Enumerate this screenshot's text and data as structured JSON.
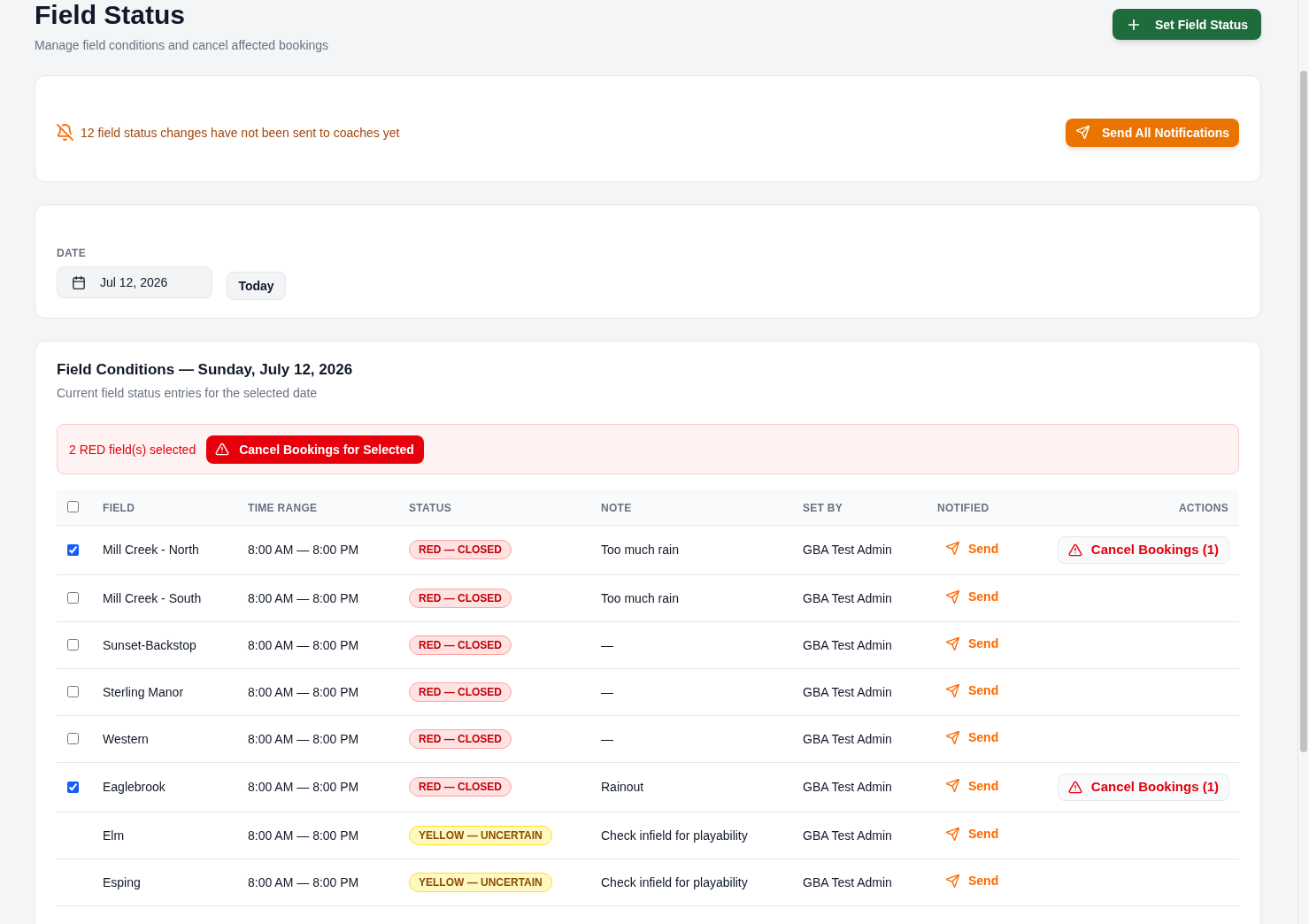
{
  "header": {
    "title": "Field Status",
    "subtitle": "Manage field conditions and cancel affected bookings",
    "primary_button": "Set Field Status"
  },
  "notification_banner": {
    "message": "12 field status changes have not been sent to coaches yet",
    "button": "Send All Notifications"
  },
  "date_filter": {
    "label": "DATE",
    "value": "Jul 12, 2026",
    "today_button": "Today"
  },
  "conditions": {
    "title": "Field Conditions — Sunday, July 12, 2026",
    "subtitle": "Current field status entries for the selected date",
    "selection_bar": {
      "message": "2 RED field(s) selected",
      "button": "Cancel Bookings for Selected"
    },
    "table": {
      "select_all": {
        "checked": false
      },
      "columns": [
        "FIELD",
        "TIME RANGE",
        "STATUS",
        "NOTE",
        "SET BY",
        "NOTIFIED",
        "ACTIONS"
      ],
      "rows": [
        {
          "selectable": true,
          "checked": true,
          "field": "Mill Creek - North",
          "time_range": "8:00 AM — 8:00 PM",
          "status": {
            "kind": "red",
            "label": "RED — CLOSED"
          },
          "note": "Too much rain",
          "set_by": "GBA Test Admin",
          "notify": "Send",
          "action": "Cancel Bookings (1)"
        },
        {
          "selectable": true,
          "checked": false,
          "field": "Mill Creek - South",
          "time_range": "8:00 AM — 8:00 PM",
          "status": {
            "kind": "red",
            "label": "RED — CLOSED"
          },
          "note": "Too much rain",
          "set_by": "GBA Test Admin",
          "notify": "Send"
        },
        {
          "selectable": true,
          "checked": false,
          "field": "Sunset-Backstop",
          "time_range": "8:00 AM — 8:00 PM",
          "status": {
            "kind": "red",
            "label": "RED — CLOSED"
          },
          "note": "—",
          "set_by": "GBA Test Admin",
          "notify": "Send"
        },
        {
          "selectable": true,
          "checked": false,
          "field": "Sterling Manor",
          "time_range": "8:00 AM — 8:00 PM",
          "status": {
            "kind": "red",
            "label": "RED — CLOSED"
          },
          "note": "—",
          "set_by": "GBA Test Admin",
          "notify": "Send"
        },
        {
          "selectable": true,
          "checked": false,
          "field": "Western",
          "time_range": "8:00 AM — 8:00 PM",
          "status": {
            "kind": "red",
            "label": "RED — CLOSED"
          },
          "note": "—",
          "set_by": "GBA Test Admin",
          "notify": "Send"
        },
        {
          "selectable": true,
          "checked": true,
          "field": "Eaglebrook",
          "time_range": "8:00 AM — 8:00 PM",
          "status": {
            "kind": "red",
            "label": "RED — CLOSED"
          },
          "note": "Rainout",
          "set_by": "GBA Test Admin",
          "notify": "Send",
          "action": "Cancel Bookings (1)"
        },
        {
          "selectable": false,
          "field": "Elm",
          "time_range": "8:00 AM — 8:00 PM",
          "status": {
            "kind": "yellow",
            "label": "YELLOW — UNCERTAIN"
          },
          "note": "Check infield for playability",
          "set_by": "GBA Test Admin",
          "notify": "Send"
        },
        {
          "selectable": false,
          "field": "Esping",
          "time_range": "8:00 AM — 8:00 PM",
          "status": {
            "kind": "yellow",
            "label": "YELLOW — UNCERTAIN"
          },
          "note": "Check infield for playability",
          "set_by": "GBA Test Admin",
          "notify": "Send"
        }
      ]
    }
  }
}
